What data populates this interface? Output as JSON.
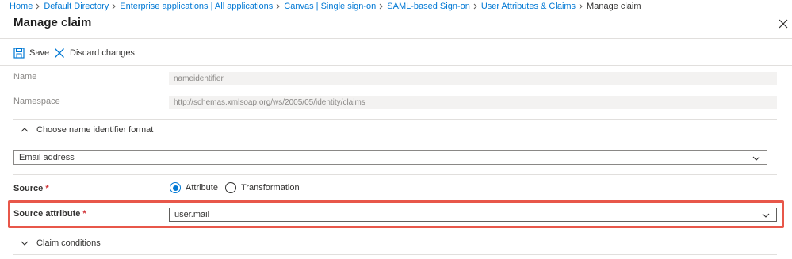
{
  "breadcrumb": {
    "items": [
      "Home",
      "Default Directory",
      "Enterprise applications | All applications",
      "Canvas | Single sign-on",
      "SAML-based Sign-on",
      "User Attributes & Claims"
    ],
    "current": "Manage claim"
  },
  "page": {
    "title": "Manage claim"
  },
  "toolbar": {
    "save_label": "Save",
    "discard_label": "Discard changes"
  },
  "form": {
    "name_label": "Name",
    "name_value": "nameidentifier",
    "namespace_label": "Namespace",
    "namespace_value": "http://schemas.xmlsoap.org/ws/2005/05/identity/claims",
    "format_section_label": "Choose name identifier format",
    "format_value": "Email address",
    "source_label": "Source",
    "source_options": [
      "Attribute",
      "Transformation"
    ],
    "source_selected": "Attribute",
    "source_attribute_label": "Source attribute",
    "source_attribute_value": "user.mail",
    "required_marker": "*",
    "claim_conditions_label": "Claim conditions"
  },
  "colors": {
    "accent": "#0078d4",
    "highlight": "#e8574a",
    "required": "#d13438"
  }
}
